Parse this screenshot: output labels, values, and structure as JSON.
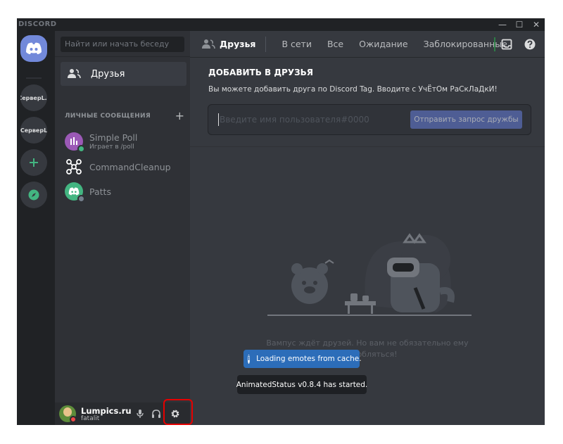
{
  "titlebar": {
    "brand": "DISCORD",
    "minimize": "—",
    "maximize": "☐",
    "close": "✕"
  },
  "servers": [
    {
      "label": "СерверL.r"
    },
    {
      "label": "СерверL"
    }
  ],
  "dm_column": {
    "search_placeholder": "Найти или начать беседу",
    "friends_label": "Друзья",
    "section_title": "ЛИЧНЫЕ СООБЩЕНИЯ",
    "section_add": "+",
    "dms": [
      {
        "name": "Simple Poll",
        "sub": "Играет в /poll",
        "avatar_color": "#9b59b6",
        "status_color": "#43b581"
      },
      {
        "name": "CommandCleanup",
        "sub": "",
        "avatar_color": "#2f3136",
        "status_color": ""
      },
      {
        "name": "Patts",
        "sub": "",
        "avatar_color": "#43b581",
        "status_color": "#747f8d"
      }
    ]
  },
  "user_panel": {
    "name": "Lumpics.ru",
    "tag": "fatalit",
    "status_color": "#f04747"
  },
  "topbar": {
    "friends_label": "Друзья",
    "tabs": [
      "В сети",
      "Все",
      "Ожидание",
      "Заблокированные"
    ]
  },
  "add_friend": {
    "title": "ДОБАВИТЬ В ДРУЗЬЯ",
    "description": "Вы можете добавить друга по Discord Tag. Вводите с УчЁтОм РаСкЛаДкИ!",
    "placeholder": "Введите имя пользователя#0000",
    "button": "Отправить запрос дружбы"
  },
  "empty_state": {
    "text": "Вампус ждёт друзей. Но вам не обязательно ему уподобляться!"
  },
  "toasts": {
    "info": "Loading emotes from cache.",
    "message": "AnimatedStatus v0.8.4 has started."
  },
  "colors": {
    "blurple": "#7289da",
    "online": "#43b581",
    "dnd": "#f04747",
    "highlight": "#e60000"
  }
}
